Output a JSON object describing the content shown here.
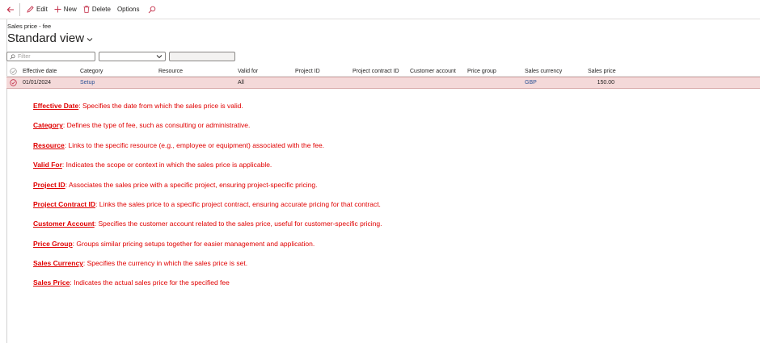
{
  "toolbar": {
    "edit_label": "Edit",
    "new_label": "New",
    "delete_label": "Delete",
    "options_label": "Options"
  },
  "header": {
    "breadcrumb": "Sales price - fee",
    "title": "Standard view"
  },
  "filter": {
    "placeholder": "Filter",
    "select_value": ""
  },
  "grid": {
    "columns": [
      "Effective date",
      "Category",
      "Resource",
      "Valid for",
      "Project ID",
      "Project contract ID",
      "Customer account",
      "Price group",
      "Sales currency",
      "Sales price"
    ],
    "rows": [
      {
        "effective_date": "01/01/2024",
        "category": "Setup",
        "resource": "",
        "valid_for": "All",
        "project_id": "",
        "project_contract_id": "",
        "customer_account": "",
        "price_group": "",
        "sales_currency": "GBP",
        "sales_price": "150.00"
      }
    ]
  },
  "descriptions": [
    {
      "term": "Effective Date",
      "text": ": Specifies the date from which the sales price is valid."
    },
    {
      "term": "Category",
      "text": ": Defines the type of fee, such as consulting or administrative."
    },
    {
      "term": "Resource",
      "text": ": Links to the specific resource (e.g., employee or equipment) associated with the fee."
    },
    {
      "term": "Valid For",
      "text": ": Indicates the scope or context in which the sales price is applicable."
    },
    {
      "term": "Project ID",
      "text": ": Associates the sales price with a specific project, ensuring project-specific pricing."
    },
    {
      "term": "Project Contract ID",
      "text": ": Links the sales price to a specific project contract, ensuring accurate pricing for that contract."
    },
    {
      "term": "Customer Account",
      "text": ": Specifies the customer account related to the sales price, useful for customer-specific pricing."
    },
    {
      "term": "Price Group",
      "text": ": Groups similar pricing setups together for easier management and application."
    },
    {
      "term": "Sales Currency",
      "text": ": Specifies the currency in which the sales price is set."
    },
    {
      "term": "Sales Price",
      "text": ": Indicates the actual sales price for the specified fee"
    }
  ],
  "colors": {
    "accent": "#c4314b",
    "annotation_red": "#e00000",
    "selected_row": "#f4d9d9",
    "link": "#2f5597"
  }
}
